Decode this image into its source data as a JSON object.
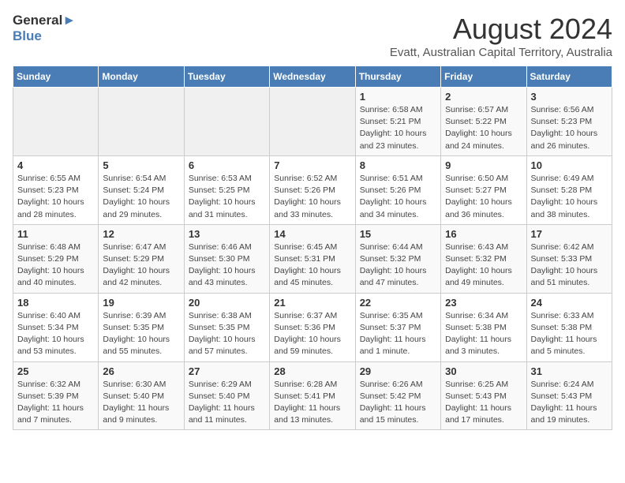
{
  "header": {
    "logo_line1": "General",
    "logo_line2": "Blue",
    "title": "August 2024",
    "subtitle": "Evatt, Australian Capital Territory, Australia"
  },
  "calendar": {
    "weekdays": [
      "Sunday",
      "Monday",
      "Tuesday",
      "Wednesday",
      "Thursday",
      "Friday",
      "Saturday"
    ],
    "weeks": [
      [
        {
          "day": "",
          "info": ""
        },
        {
          "day": "",
          "info": ""
        },
        {
          "day": "",
          "info": ""
        },
        {
          "day": "",
          "info": ""
        },
        {
          "day": "1",
          "info": "Sunrise: 6:58 AM\nSunset: 5:21 PM\nDaylight: 10 hours\nand 23 minutes."
        },
        {
          "day": "2",
          "info": "Sunrise: 6:57 AM\nSunset: 5:22 PM\nDaylight: 10 hours\nand 24 minutes."
        },
        {
          "day": "3",
          "info": "Sunrise: 6:56 AM\nSunset: 5:23 PM\nDaylight: 10 hours\nand 26 minutes."
        }
      ],
      [
        {
          "day": "4",
          "info": "Sunrise: 6:55 AM\nSunset: 5:23 PM\nDaylight: 10 hours\nand 28 minutes."
        },
        {
          "day": "5",
          "info": "Sunrise: 6:54 AM\nSunset: 5:24 PM\nDaylight: 10 hours\nand 29 minutes."
        },
        {
          "day": "6",
          "info": "Sunrise: 6:53 AM\nSunset: 5:25 PM\nDaylight: 10 hours\nand 31 minutes."
        },
        {
          "day": "7",
          "info": "Sunrise: 6:52 AM\nSunset: 5:26 PM\nDaylight: 10 hours\nand 33 minutes."
        },
        {
          "day": "8",
          "info": "Sunrise: 6:51 AM\nSunset: 5:26 PM\nDaylight: 10 hours\nand 34 minutes."
        },
        {
          "day": "9",
          "info": "Sunrise: 6:50 AM\nSunset: 5:27 PM\nDaylight: 10 hours\nand 36 minutes."
        },
        {
          "day": "10",
          "info": "Sunrise: 6:49 AM\nSunset: 5:28 PM\nDaylight: 10 hours\nand 38 minutes."
        }
      ],
      [
        {
          "day": "11",
          "info": "Sunrise: 6:48 AM\nSunset: 5:29 PM\nDaylight: 10 hours\nand 40 minutes."
        },
        {
          "day": "12",
          "info": "Sunrise: 6:47 AM\nSunset: 5:29 PM\nDaylight: 10 hours\nand 42 minutes."
        },
        {
          "day": "13",
          "info": "Sunrise: 6:46 AM\nSunset: 5:30 PM\nDaylight: 10 hours\nand 43 minutes."
        },
        {
          "day": "14",
          "info": "Sunrise: 6:45 AM\nSunset: 5:31 PM\nDaylight: 10 hours\nand 45 minutes."
        },
        {
          "day": "15",
          "info": "Sunrise: 6:44 AM\nSunset: 5:32 PM\nDaylight: 10 hours\nand 47 minutes."
        },
        {
          "day": "16",
          "info": "Sunrise: 6:43 AM\nSunset: 5:32 PM\nDaylight: 10 hours\nand 49 minutes."
        },
        {
          "day": "17",
          "info": "Sunrise: 6:42 AM\nSunset: 5:33 PM\nDaylight: 10 hours\nand 51 minutes."
        }
      ],
      [
        {
          "day": "18",
          "info": "Sunrise: 6:40 AM\nSunset: 5:34 PM\nDaylight: 10 hours\nand 53 minutes."
        },
        {
          "day": "19",
          "info": "Sunrise: 6:39 AM\nSunset: 5:35 PM\nDaylight: 10 hours\nand 55 minutes."
        },
        {
          "day": "20",
          "info": "Sunrise: 6:38 AM\nSunset: 5:35 PM\nDaylight: 10 hours\nand 57 minutes."
        },
        {
          "day": "21",
          "info": "Sunrise: 6:37 AM\nSunset: 5:36 PM\nDaylight: 10 hours\nand 59 minutes."
        },
        {
          "day": "22",
          "info": "Sunrise: 6:35 AM\nSunset: 5:37 PM\nDaylight: 11 hours\nand 1 minute."
        },
        {
          "day": "23",
          "info": "Sunrise: 6:34 AM\nSunset: 5:38 PM\nDaylight: 11 hours\nand 3 minutes."
        },
        {
          "day": "24",
          "info": "Sunrise: 6:33 AM\nSunset: 5:38 PM\nDaylight: 11 hours\nand 5 minutes."
        }
      ],
      [
        {
          "day": "25",
          "info": "Sunrise: 6:32 AM\nSunset: 5:39 PM\nDaylight: 11 hours\nand 7 minutes."
        },
        {
          "day": "26",
          "info": "Sunrise: 6:30 AM\nSunset: 5:40 PM\nDaylight: 11 hours\nand 9 minutes."
        },
        {
          "day": "27",
          "info": "Sunrise: 6:29 AM\nSunset: 5:40 PM\nDaylight: 11 hours\nand 11 minutes."
        },
        {
          "day": "28",
          "info": "Sunrise: 6:28 AM\nSunset: 5:41 PM\nDaylight: 11 hours\nand 13 minutes."
        },
        {
          "day": "29",
          "info": "Sunrise: 6:26 AM\nSunset: 5:42 PM\nDaylight: 11 hours\nand 15 minutes."
        },
        {
          "day": "30",
          "info": "Sunrise: 6:25 AM\nSunset: 5:43 PM\nDaylight: 11 hours\nand 17 minutes."
        },
        {
          "day": "31",
          "info": "Sunrise: 6:24 AM\nSunset: 5:43 PM\nDaylight: 11 hours\nand 19 minutes."
        }
      ]
    ]
  }
}
